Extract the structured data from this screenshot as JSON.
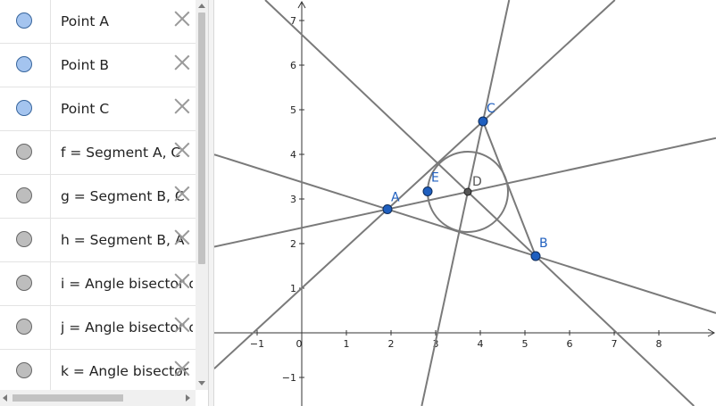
{
  "algebra": {
    "rows": [
      {
        "text": "Point A",
        "color": "blue",
        "kind": "point-a"
      },
      {
        "text": "Point B",
        "color": "blue",
        "kind": "point-b"
      },
      {
        "text": "Point C",
        "color": "blue",
        "kind": "point-c"
      },
      {
        "text": "f = Segment A, C",
        "color": "gray",
        "kind": "segment-f"
      },
      {
        "text": "g = Segment B, C",
        "color": "gray",
        "kind": "segment-g"
      },
      {
        "text": "h = Segment B, A",
        "color": "gray",
        "kind": "segment-h"
      },
      {
        "text": "i = Angle bisector o",
        "color": "gray",
        "kind": "bisector-i"
      },
      {
        "text": "j = Angle bisector o",
        "color": "gray",
        "kind": "bisector-j"
      },
      {
        "text": "k = Angle bisector o",
        "color": "gray",
        "kind": "bisector-k"
      }
    ]
  },
  "graphics": {
    "x_ticks": [
      "−1",
      "0",
      "1",
      "2",
      "3",
      "4",
      "5",
      "6",
      "7",
      "8"
    ],
    "x_tick_values": [
      -1,
      0,
      1,
      2,
      3,
      4,
      5,
      6,
      7,
      8
    ],
    "y_ticks": [
      "−1",
      "1",
      "2",
      "3",
      "4",
      "5",
      "6",
      "7"
    ],
    "y_tick_values": [
      -1,
      1,
      2,
      3,
      4,
      5,
      6,
      7
    ],
    "points": [
      {
        "label": "A",
        "x": 1.92,
        "y": 2.77,
        "style": "free"
      },
      {
        "label": "B",
        "x": 5.24,
        "y": 1.72,
        "style": "free"
      },
      {
        "label": "C",
        "x": 4.06,
        "y": 4.74,
        "style": "free"
      },
      {
        "label": "D",
        "x": 3.72,
        "y": 3.16,
        "style": "dependent"
      },
      {
        "label": "E",
        "x": 2.82,
        "y": 3.17,
        "style": "free"
      }
    ],
    "lines": [
      {
        "name": "i",
        "through": [
          [
            1.92,
            2.77
          ],
          [
            3.72,
            3.16
          ]
        ]
      },
      {
        "name": "j",
        "through": [
          [
            5.24,
            1.72
          ],
          [
            3.72,
            3.16
          ]
        ]
      },
      {
        "name": "k",
        "through": [
          [
            4.06,
            4.74
          ],
          [
            3.72,
            3.16
          ]
        ]
      },
      {
        "name": "f",
        "through": [
          [
            1.92,
            2.77
          ],
          [
            4.06,
            4.74
          ]
        ]
      },
      {
        "name": "h",
        "through": [
          [
            1.92,
            2.77
          ],
          [
            5.24,
            1.72
          ]
        ]
      }
    ],
    "segments": [
      {
        "name": "g",
        "from": [
          5.24,
          1.72
        ],
        "to": [
          4.06,
          4.74
        ]
      }
    ],
    "circle": {
      "center": [
        3.72,
        3.16
      ],
      "radius": 0.9
    },
    "colors": {
      "line": "#7a7a7a",
      "point_fill": "#1f5fbf",
      "point_label": "#1f5fbf",
      "dependent_fill": "#555555"
    }
  }
}
